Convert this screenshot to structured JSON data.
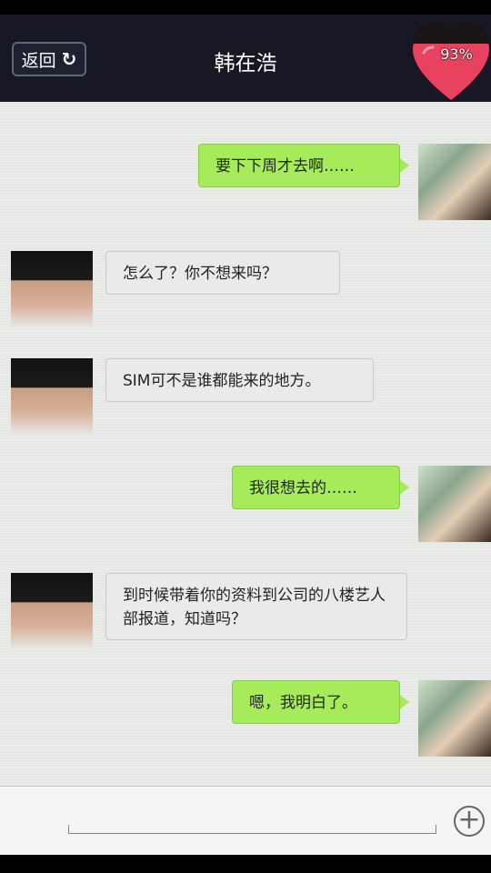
{
  "header": {
    "back_label": "返回",
    "title": "韩在浩",
    "affinity": "93%"
  },
  "messages": [
    {
      "side": "right",
      "text": "要下下周才去啊……"
    },
    {
      "side": "left",
      "text": "怎么了？你不想来吗？"
    },
    {
      "side": "left",
      "text": "SIM可不是谁都能来的地方。"
    },
    {
      "side": "right",
      "text": "我很想去的……"
    },
    {
      "side": "left",
      "text": "到时候带着你的资料到公司的八楼艺人部报道，知道吗？"
    },
    {
      "side": "right",
      "text": "嗯，我明白了。"
    }
  ],
  "icons": {
    "refresh": "refresh-icon",
    "heart": "heart-icon",
    "plus": "plus-icon"
  },
  "colors": {
    "header_bg": "#181824",
    "chat_bg": "#e9ebe8",
    "bubble_self": "#a6ec5a",
    "bubble_other": "#eaeaea",
    "heart": "#e8425e"
  }
}
